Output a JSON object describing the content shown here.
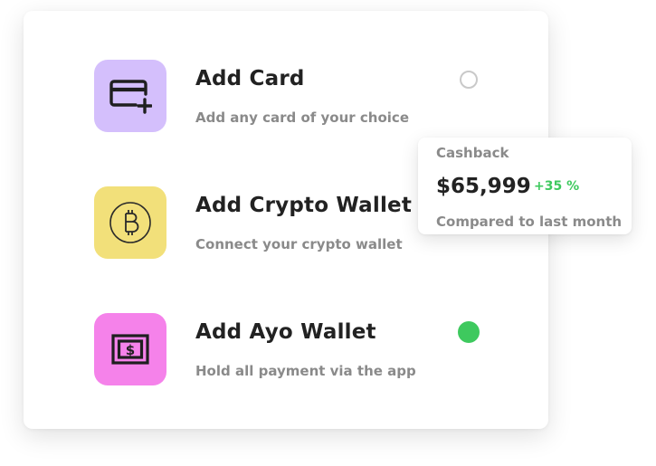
{
  "options": [
    {
      "title": "Add Card",
      "subtitle": "Add any card of your choice",
      "icon": "credit-card-add-icon",
      "tile_color": "#d4bffc",
      "selected": false
    },
    {
      "title": "Add Crypto Wallet",
      "subtitle": "Connect your crypto wallet",
      "icon": "bitcoin-icon",
      "tile_color": "#f2e07a",
      "selected": null
    },
    {
      "title": "Add Ayo Wallet",
      "subtitle": "Hold all payment via the app",
      "icon": "cash-dollar-icon",
      "tile_color": "#f582ea",
      "selected": true
    }
  ],
  "cashback": {
    "title": "Cashback",
    "amount": "$65,999",
    "change": "+35 %",
    "note": "Compared to last month"
  },
  "colors": {
    "accent_green": "#3ec95e",
    "text_dark": "#222222",
    "text_muted": "#8a8a8a",
    "radio_border": "#c9c9c9"
  }
}
